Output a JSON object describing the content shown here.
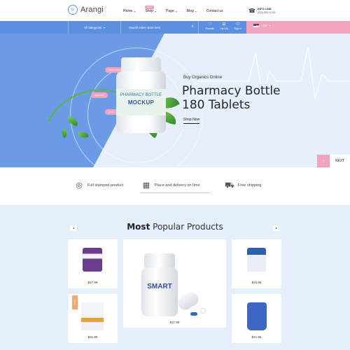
{
  "header": {
    "logo_text": "Arangi",
    "nav": [
      {
        "label": "Home",
        "caret": "▾"
      },
      {
        "label": "Shop",
        "caret": "▾",
        "badge": "NEW"
      },
      {
        "label": "Page",
        "caret": "▾"
      },
      {
        "label": "Blog",
        "caret": "▾"
      },
      {
        "label": "Contact us",
        "caret": ""
      }
    ],
    "info_title": "INFO LINE",
    "info_phone": "(032) 800-12-99"
  },
  "toolbar": {
    "categories_label": "All categories",
    "categories_caret": "▾",
    "search_placeholder": "Search entire store here",
    "icons": [
      {
        "label": "Favorite",
        "icon": "heart-icon",
        "glyph": "♡"
      },
      {
        "label": "Cart (0)",
        "icon": "cart-icon",
        "glyph": "🛒"
      },
      {
        "label": "Sign in",
        "icon": "user-icon",
        "glyph": "👤"
      }
    ],
    "currency": "USD",
    "currency_caret": "▾"
  },
  "hero": {
    "subtitle": "Buy Organics Online",
    "title_line1": "Pharmacy Bottle",
    "title_line2": "180 Tablets",
    "cta": "Shop Now",
    "bottle_label_1": "PHARMACY BOTTLE",
    "bottle_label_2": "MOCKUP",
    "tags": [
      "VEGETABLE",
      "HEALTHY",
      "100%"
    ],
    "prev_glyph": "‹",
    "next_label": "NEXT"
  },
  "features": [
    {
      "label": "Full stamped product",
      "icon": "stamp-icon",
      "glyph": "⚙"
    },
    {
      "label": "Place and delivery on time",
      "icon": "calendar-icon",
      "glyph": "▦"
    },
    {
      "label": "Free shipping",
      "icon": "truck-icon",
      "glyph": "⛟"
    }
  ],
  "products_section": {
    "title_bold": "Most",
    "title_rest": "Popular Products",
    "prev_glyph": "◂",
    "next_glyph": "▸",
    "sale_badge": "SALE",
    "products": [
      {
        "price": "$17.99",
        "color": "#6a3d8f"
      },
      {
        "price": "$17.99",
        "color": "#2a64b8"
      },
      {
        "price": "$15.85",
        "color": "#2c5fb0"
      },
      {
        "price": "$31.85",
        "color": "#e8a13a"
      },
      {
        "price": "$21.85",
        "color": "#3d66c4"
      }
    ],
    "smart_label": "SMART"
  },
  "colors": {
    "primary_blue": "#5b8fe0",
    "accent_pink": "#f3a3be",
    "section_bg": "#e5eefb"
  }
}
